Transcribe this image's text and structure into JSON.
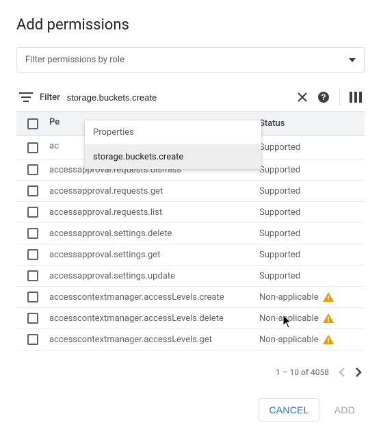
{
  "dialog": {
    "title": "Add permissions"
  },
  "roleFilter": {
    "placeholder": "Filter permissions by role"
  },
  "filter": {
    "label": "Filter",
    "input_value": "storage.buckets.create"
  },
  "autocomplete": {
    "header": "Properties",
    "suggestion": "storage.buckets.create"
  },
  "table": {
    "headers": {
      "permission": "Permission",
      "permission_truncated": "Pe",
      "status": "Status"
    },
    "rows": [
      {
        "permission": "accessapproval.requests.approve",
        "permission_truncated": "ac",
        "status": "Supported",
        "warning": false
      },
      {
        "permission": "accessapproval.requests.dismiss",
        "status": "Supported",
        "warning": false
      },
      {
        "permission": "accessapproval.requests.get",
        "status": "Supported",
        "warning": false
      },
      {
        "permission": "accessapproval.requests.list",
        "status": "Supported",
        "warning": false
      },
      {
        "permission": "accessapproval.settings.delete",
        "status": "Supported",
        "warning": false
      },
      {
        "permission": "accessapproval.settings.get",
        "status": "Supported",
        "warning": false
      },
      {
        "permission": "accessapproval.settings.update",
        "status": "Supported",
        "warning": false
      },
      {
        "permission": "accesscontextmanager.accessLevels.create",
        "status": "Non-applicable",
        "warning": true
      },
      {
        "permission": "accesscontextmanager.accessLevels.delete",
        "status": "Non-applicable",
        "warning": true
      },
      {
        "permission": "accesscontextmanager.accessLevels.get",
        "status": "Non-applicable",
        "warning": true
      }
    ]
  },
  "pagination": {
    "range_text": "1 – 10 of 4058"
  },
  "actions": {
    "cancel_label": "CANCEL",
    "add_label": "ADD"
  }
}
